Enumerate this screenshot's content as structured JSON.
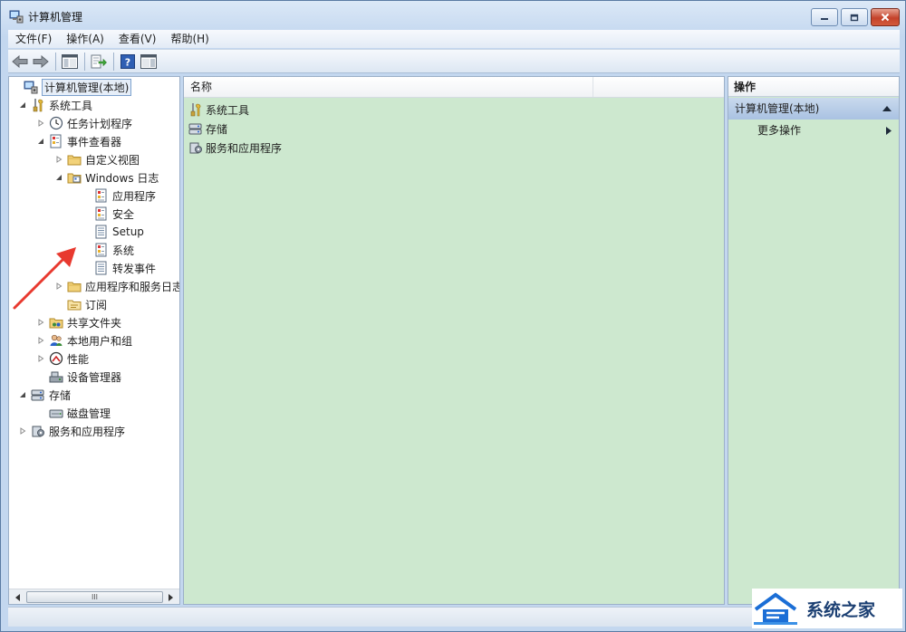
{
  "window": {
    "title": "计算机管理"
  },
  "menu": [
    "文件(F)",
    "操作(A)",
    "查看(V)",
    "帮助(H)"
  ],
  "tree": [
    {
      "label": "计算机管理(本地)",
      "level": 0,
      "expander": "none",
      "icon": "computer-management-icon",
      "selected": true
    },
    {
      "label": "系统工具",
      "level": 1,
      "expander": "expanded",
      "icon": "system-tools-icon"
    },
    {
      "label": "任务计划程序",
      "level": 2,
      "expander": "collapsed",
      "icon": "clock-icon"
    },
    {
      "label": "事件查看器",
      "level": 2,
      "expander": "expanded",
      "icon": "event-viewer-icon"
    },
    {
      "label": "自定义视图",
      "level": 3,
      "expander": "collapsed",
      "icon": "folder-icon"
    },
    {
      "label": "Windows 日志",
      "level": 3,
      "expander": "expanded",
      "icon": "windows-log-icon"
    },
    {
      "label": "应用程序",
      "level": 4,
      "expander": "none",
      "icon": "event-log-icon"
    },
    {
      "label": "安全",
      "level": 4,
      "expander": "none",
      "icon": "event-log-icon"
    },
    {
      "label": "Setup",
      "level": 4,
      "expander": "none",
      "icon": "log-icon"
    },
    {
      "label": "系统",
      "level": 4,
      "expander": "none",
      "icon": "event-log-icon"
    },
    {
      "label": "转发事件",
      "level": 4,
      "expander": "none",
      "icon": "log-icon"
    },
    {
      "label": "应用程序和服务日志",
      "level": 3,
      "expander": "collapsed",
      "icon": "folder-icon"
    },
    {
      "label": "订阅",
      "level": 3,
      "expander": "none",
      "icon": "subscription-icon"
    },
    {
      "label": "共享文件夹",
      "level": 2,
      "expander": "collapsed",
      "icon": "shared-folder-icon"
    },
    {
      "label": "本地用户和组",
      "level": 2,
      "expander": "collapsed",
      "icon": "users-icon"
    },
    {
      "label": "性能",
      "level": 2,
      "expander": "collapsed",
      "icon": "performance-icon"
    },
    {
      "label": "设备管理器",
      "level": 2,
      "expander": "none",
      "icon": "device-manager-icon"
    },
    {
      "label": "存储",
      "level": 1,
      "expander": "expanded",
      "icon": "storage-icon"
    },
    {
      "label": "磁盘管理",
      "level": 2,
      "expander": "none",
      "icon": "disk-icon"
    },
    {
      "label": "服务和应用程序",
      "level": 1,
      "expander": "collapsed",
      "icon": "services-icon"
    }
  ],
  "list": {
    "column": "名称",
    "items": [
      {
        "label": "系统工具",
        "icon": "system-tools-icon"
      },
      {
        "label": "存储",
        "icon": "storage-icon"
      },
      {
        "label": "服务和应用程序",
        "icon": "services-icon"
      }
    ]
  },
  "actions": {
    "header": "操作",
    "group": "计算机管理(本地)",
    "item": "更多操作"
  },
  "scrollbar": {
    "thumb_label": "III"
  },
  "watermark": {
    "text": "系统之家"
  },
  "colors": {
    "content_bg": "#cde8cf",
    "accent": "#1b3f72",
    "arrow": "#e8392f"
  }
}
